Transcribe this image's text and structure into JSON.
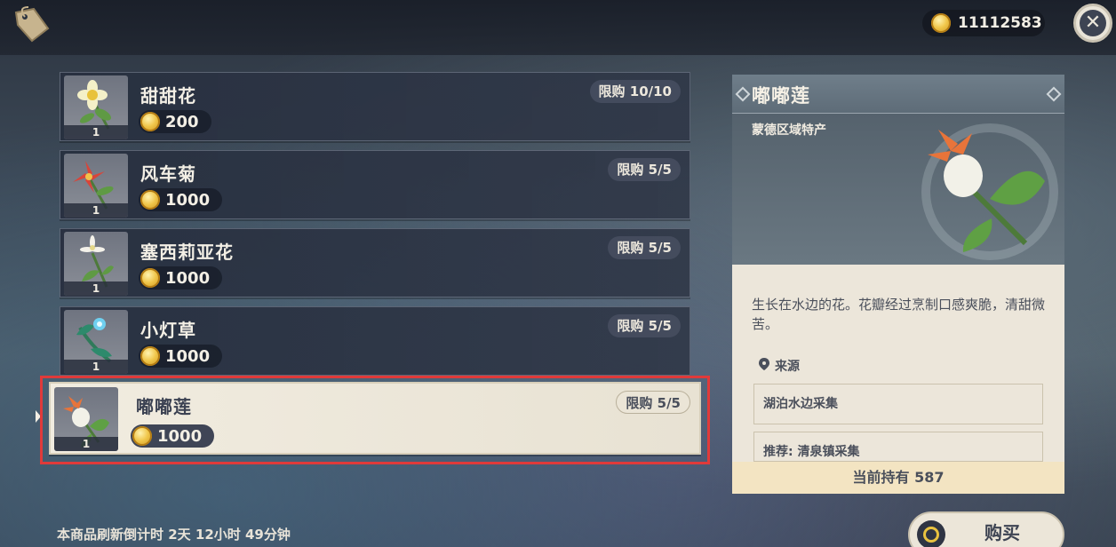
{
  "header": {
    "icons": [
      "tag-icon",
      "coin-icon",
      "close-icon"
    ],
    "currency_amount": "11112583"
  },
  "items": [
    {
      "name": "甜甜花",
      "price": "200",
      "limit": "限购 10/10",
      "qty": "1",
      "icon": "sweet-flower-icon"
    },
    {
      "name": "风车菊",
      "price": "1000",
      "limit": "限购 5/5",
      "qty": "1",
      "icon": "windwheel-aster-icon"
    },
    {
      "name": "塞西莉亚花",
      "price": "1000",
      "limit": "限购 5/5",
      "qty": "1",
      "icon": "cecilia-icon"
    },
    {
      "name": "小灯草",
      "price": "1000",
      "limit": "限购 5/5",
      "qty": "1",
      "icon": "small-lamp-grass-icon"
    },
    {
      "name": "嘟嘟莲",
      "price": "1000",
      "limit": "限购 5/5",
      "qty": "1",
      "icon": "calla-lily-icon"
    }
  ],
  "selected_index": 4,
  "detail": {
    "title": "嘟嘟莲",
    "region": "蒙德区域特产",
    "description": "生长在水边的花。花瓣经过烹制口感爽脆，清甜微苦。",
    "source_heading": "来源",
    "sources": [
      "湖泊水边采集",
      "推荐: 清泉镇采集"
    ],
    "owned": "当前持有 587"
  },
  "footer": {
    "refresh_text": "本商品刷新倒计时 2天 12小时 49分钟",
    "buy_label": "购买"
  },
  "colors": {
    "selected_outline": "#e03a3a",
    "card_dark": "#2f3848",
    "card_light": "#f1ece0",
    "coin": "#f0c64a"
  }
}
